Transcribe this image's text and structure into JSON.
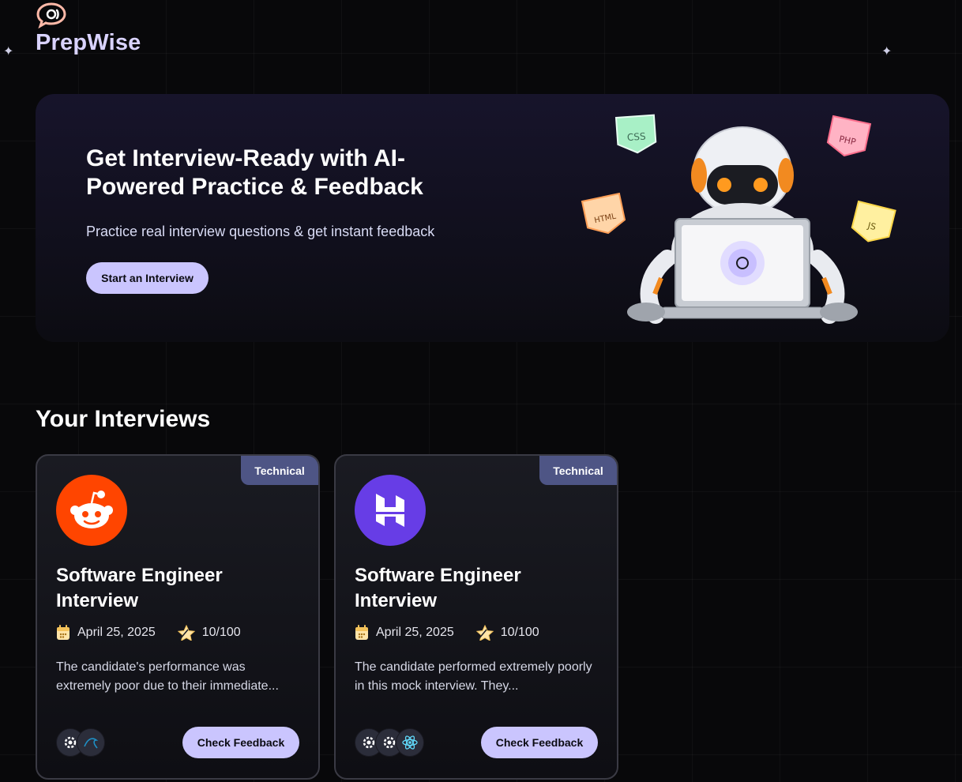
{
  "brand": {
    "name": "PrepWise",
    "logo_icon": "chat-bubble-icon"
  },
  "hero": {
    "title": "Get Interview-Ready with AI-Powered Practice & Feedback",
    "subtitle": "Practice real interview questions & get instant feedback",
    "cta_label": "Start an Interview",
    "tags": {
      "css": "CSS",
      "php": "PHP",
      "html": "HTML",
      "js": "JS"
    }
  },
  "section": {
    "title": "Your Interviews"
  },
  "cards": [
    {
      "badge": "Technical",
      "logo_icon": "reddit-icon",
      "title": "Software Engineer Interview",
      "date": "April 25, 2025",
      "score": "10/100",
      "description": "The candidate's performance was extremely poor due to their immediate...",
      "tech_icons": [
        "tech-generic-icon",
        "mysql-icon"
      ],
      "button_label": "Check Feedback"
    },
    {
      "badge": "Technical",
      "logo_icon": "hostinger-icon",
      "title": "Software Engineer Interview",
      "date": "April 25, 2025",
      "score": "10/100",
      "description": "The candidate performed extremely poorly in this mock interview. They...",
      "tech_icons": [
        "tech-generic-icon",
        "tech-generic-icon",
        "react-icon"
      ],
      "button_label": "Check Feedback"
    }
  ],
  "colors": {
    "accent": "#cac5fe",
    "badge": "#4e5585",
    "brand_name": "#d9d3ff",
    "reddit": "#ff4500",
    "hostinger": "#673de6"
  }
}
